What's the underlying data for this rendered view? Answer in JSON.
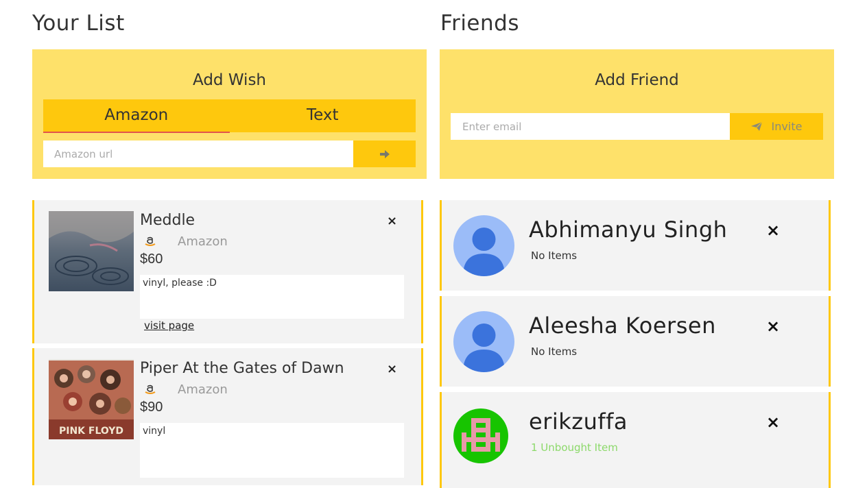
{
  "your_list": {
    "title": "Your List",
    "add_wish": {
      "title": "Add Wish",
      "tabs": [
        {
          "label": "Amazon",
          "active": true
        },
        {
          "label": "Text",
          "active": false
        }
      ],
      "url_placeholder": "Amazon url",
      "submit_icon": "arrow-right-icon"
    },
    "wishes": [
      {
        "name": "Meddle",
        "source": "Amazon",
        "price": "$60",
        "note": "vinyl, please :D",
        "link": "visit page"
      },
      {
        "name": "Piper At the Gates of Dawn",
        "source": "Amazon",
        "price": "$90",
        "note": "vinyl",
        "thumb_text": "PINK FLOYD"
      }
    ]
  },
  "friends": {
    "title": "Friends",
    "add_friend": {
      "title": "Add Friend",
      "email_placeholder": "Enter email",
      "invite_label": "Invite",
      "invite_icon": "paper-plane-icon"
    },
    "list": [
      {
        "name": "Abhimanyu Singh",
        "status": "No Items"
      },
      {
        "name": "Aleesha Koersen",
        "status": "No Items"
      },
      {
        "name": "erikzuffa",
        "status": "1 Unbought Item"
      }
    ]
  },
  "colors": {
    "panel_yellow": "#fee16a",
    "accent_yellow": "#fec80d",
    "tab_underline": "#e2544c",
    "card_bg": "#f3f3f3",
    "unbought_green": "#8cd96a",
    "avatar_blue": "#9bbcf8",
    "avatar_person_blue": "#3b73dc"
  },
  "remove_icon": "×"
}
